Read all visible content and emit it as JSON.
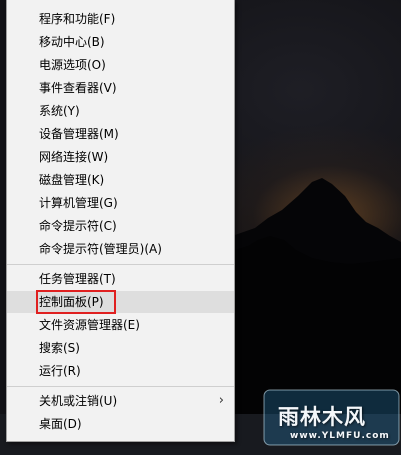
{
  "context_menu": {
    "items": [
      {
        "label": "程序和功能(F)"
      },
      {
        "label": "移动中心(B)"
      },
      {
        "label": "电源选项(O)"
      },
      {
        "label": "事件查看器(V)"
      },
      {
        "label": "系统(Y)"
      },
      {
        "label": "设备管理器(M)"
      },
      {
        "label": "网络连接(W)"
      },
      {
        "label": "磁盘管理(K)"
      },
      {
        "label": "计算机管理(G)"
      },
      {
        "label": "命令提示符(C)"
      },
      {
        "label": "命令提示符(管理员)(A)"
      },
      {
        "label": "任务管理器(T)"
      },
      {
        "label": "控制面板(P)",
        "highlighted": true
      },
      {
        "label": "文件资源管理器(E)"
      },
      {
        "label": "搜索(S)"
      },
      {
        "label": "运行(R)"
      },
      {
        "label": "关机或注销(U)",
        "has_submenu": true
      },
      {
        "label": "桌面(D)"
      }
    ],
    "highlight_color": "#e02020",
    "hover_color": "#dedede"
  },
  "watermark": {
    "brand": "雨林木风",
    "url": "www.YLMFU.com"
  }
}
